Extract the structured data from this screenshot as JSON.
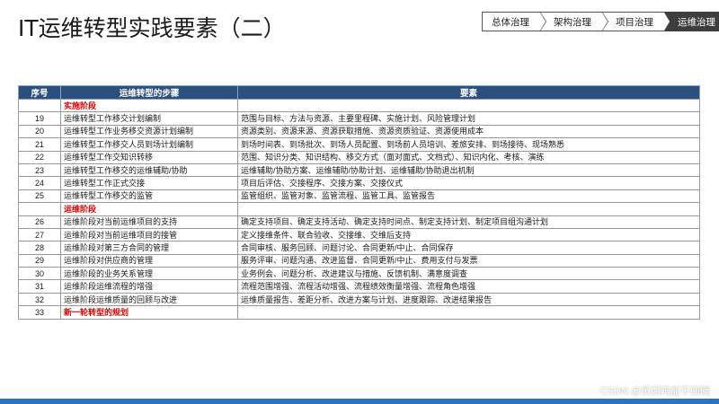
{
  "page_title": "IT运维转型实践要素（二）",
  "breadcrumb": [
    {
      "label": "总体治理",
      "active": false
    },
    {
      "label": "架构治理",
      "active": false
    },
    {
      "label": "项目治理",
      "active": false
    },
    {
      "label": "运维治理",
      "active": true
    }
  ],
  "table": {
    "headers": [
      "序号",
      "运维转型的步骤",
      "要素"
    ],
    "rows": [
      {
        "type": "stage",
        "label": "实施阶段"
      },
      {
        "num": "19",
        "step": "运维转型工作移交计划编制",
        "elements": "范围与目标、方法与资源、主要里程碑、实施计划、风险管理计划"
      },
      {
        "num": "20",
        "step": "运维转型工作业务移交资源计划编制",
        "elements": "资源类别、资源来源、资源获取措施、资源资质验证、资源使用成本"
      },
      {
        "num": "21",
        "step": "运维转型工作移交人员到场计划编制",
        "elements": "到场时间表、到场批次、到场人员配置、到场前人员培训、差旅安排、到场接待、现场熟悉"
      },
      {
        "num": "22",
        "step": "运维转型工作交知识转移",
        "elements": "范围、知识分类、知识结构、移交方式（面对面式、文档式）、知识内化、考核、演练"
      },
      {
        "num": "23",
        "step": "运维转型工作移交的运维辅助/协助",
        "elements": "运维辅助/协助方案、运维辅助/协助计划、运维辅助/协助退出机制"
      },
      {
        "num": "24",
        "step": "运维转型工作正式交接",
        "elements": "项目后评估、交接程序、交接方案、交接仪式"
      },
      {
        "num": "25",
        "step": "运维转型工作移交的监管",
        "elements": "监管组织、监管对象、监管流程、监管工具、监管报告"
      },
      {
        "type": "stage",
        "label": "运维阶段"
      },
      {
        "num": "26",
        "step": "运维阶段对当前运维项目的支持",
        "elements": "确定支持项目、确定支持活动、确定支持时间点、制定支持计划、制定项目组沟通计划"
      },
      {
        "num": "27",
        "step": "运维阶段对当前运维项目的接管",
        "elements": "定义接维条件、联合验收、交接维、交维后支持"
      },
      {
        "num": "28",
        "step": "运维阶段对第三方合同的管理",
        "elements": "合同审核、服务回顾、问题讨论、合同更新/中止、合同保存"
      },
      {
        "num": "29",
        "step": "运维阶段对供应商的管理",
        "elements": "服务评审、问题沟通、改进监督、合同更新/中止、费用支付与发票"
      },
      {
        "num": "30",
        "step": "运维阶段的业务关系管理",
        "elements": "业务例会、问题分析、改进建议与措施、反馈机制、满意度调查"
      },
      {
        "num": "31",
        "step": "运维阶段运维流程的增强",
        "elements": "流程范围增强、流程活动增强、流程绩效衡量增强、流程角色增强"
      },
      {
        "num": "32",
        "step": "运维阶段运维质量的回顾与改进",
        "elements": "运维质量报告、差距分析、改进方案与计划、进度跟踪、改进结果报告"
      },
      {
        "num": "33",
        "step": "新一轮转型的规划",
        "elements": "",
        "highlight": true
      }
    ]
  },
  "watermark": "CSDN @黄焖鸡能干四碗",
  "colors": {
    "header_bg": "#2b4f7e",
    "stage_text": "#e00000",
    "bottom_bar": "#2a74c0"
  }
}
